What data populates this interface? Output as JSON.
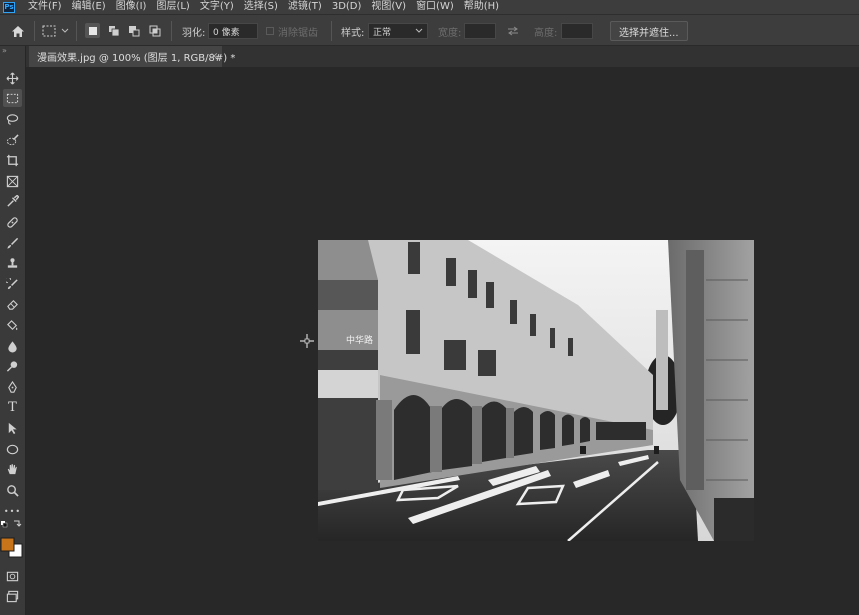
{
  "app": {
    "logo_text": "Ps"
  },
  "menu": {
    "items": [
      {
        "label": "文件(F)"
      },
      {
        "label": "编辑(E)"
      },
      {
        "label": "图像(I)"
      },
      {
        "label": "图层(L)"
      },
      {
        "label": "文字(Y)"
      },
      {
        "label": "选择(S)"
      },
      {
        "label": "滤镜(T)"
      },
      {
        "label": "3D(D)"
      },
      {
        "label": "视图(V)"
      },
      {
        "label": "窗口(W)"
      },
      {
        "label": "帮助(H)"
      }
    ]
  },
  "options": {
    "feather_label": "羽化:",
    "feather_value": "0 像素",
    "antialias_label": "消除锯齿",
    "style_label": "样式:",
    "style_value": "正常",
    "width_label": "宽度:",
    "height_label": "高度:",
    "select_mask_label": "选择并遮住..."
  },
  "document": {
    "tab_title": "漫画效果.jpg @ 100% (图层 1, RGB/8#) *",
    "close_glyph": "×"
  },
  "toolbar": {
    "collapse_glyph": "»",
    "type_tool_glyph": "T",
    "more_glyph": "•••"
  },
  "colors": {
    "foreground": "#c8741a",
    "background": "#ffffff",
    "accent": "#31a8ff"
  },
  "photo": {
    "sign_text": "中华路"
  }
}
